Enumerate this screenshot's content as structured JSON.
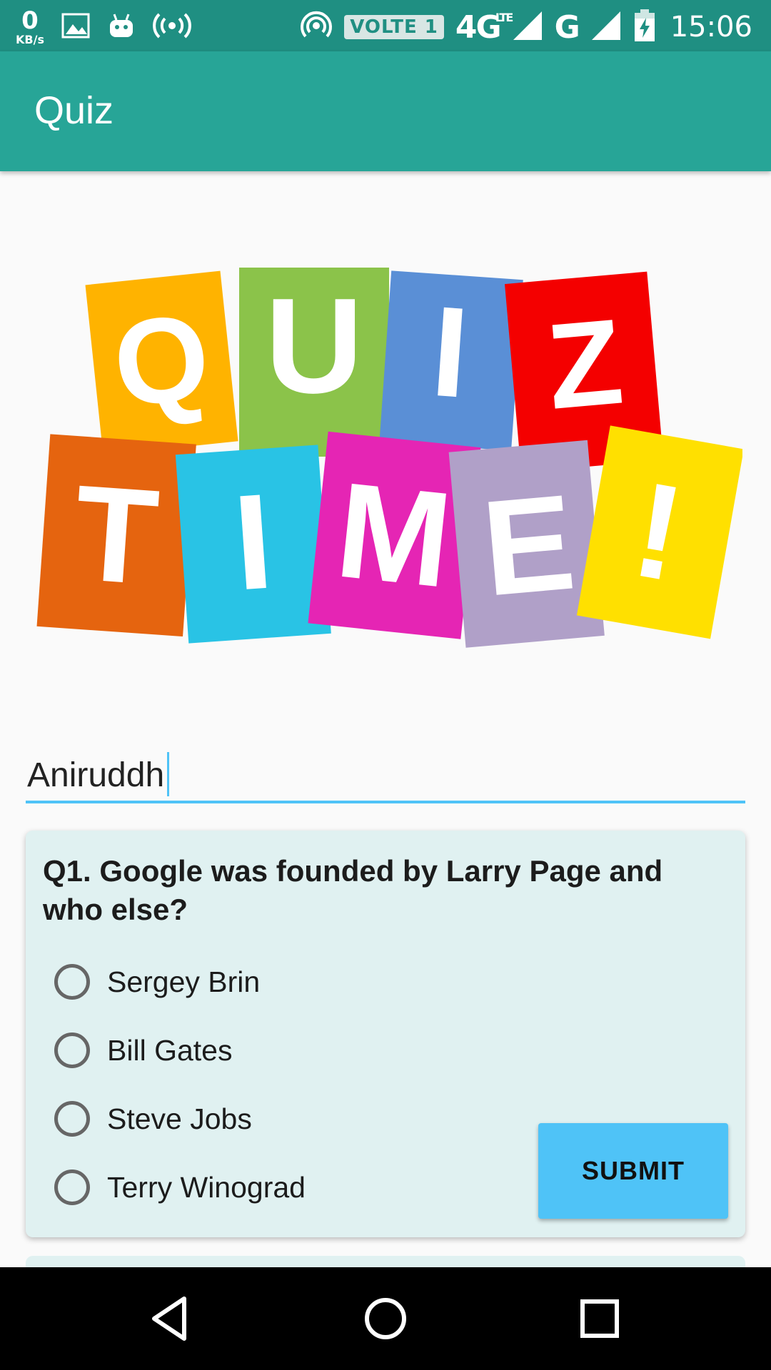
{
  "status_bar": {
    "speed_value": "0",
    "speed_unit": "KB/s",
    "volte": "VOLTE 1",
    "network": "4G",
    "lte": "LTE",
    "network2": "G",
    "time": "15:06",
    "color": "#1f8f82"
  },
  "app_bar": {
    "title": "Quiz",
    "color": "#27a597"
  },
  "logo": {
    "row1": [
      "Q",
      "U",
      "I",
      "Z"
    ],
    "row2": [
      "T",
      "I",
      "M",
      "E",
      "!"
    ],
    "colors": [
      "#ffb300",
      "#8bc34a",
      "#5a8fd6",
      "#f40000",
      "#e5640f",
      "#29c3e5",
      "#e525b4",
      "#b0a0c8",
      "#ffe000"
    ]
  },
  "name_field": {
    "value": "Aniruddh"
  },
  "question_card": {
    "question": "Q1. Google was founded by Larry Page and who else?",
    "options": [
      "Sergey Brin",
      "Bill Gates",
      "Steve Jobs",
      "Terry Winograd"
    ],
    "submit_label": "SUBMIT"
  },
  "nav_bar": {
    "icons": [
      "back-icon",
      "home-icon",
      "recents-icon"
    ]
  }
}
